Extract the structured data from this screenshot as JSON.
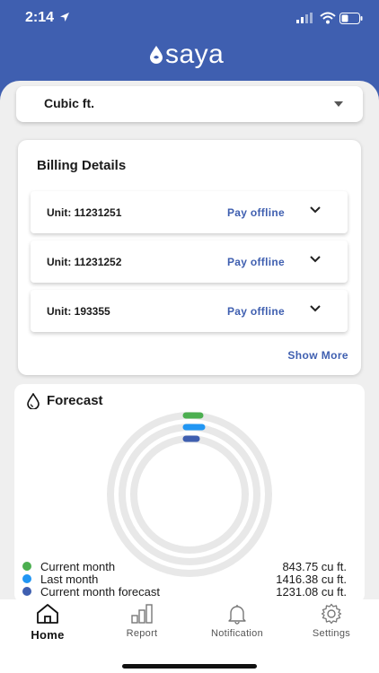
{
  "status_bar": {
    "time": "2:14"
  },
  "brand": {
    "name": "saya"
  },
  "unit_selector": {
    "value": "Cubic ft."
  },
  "billing": {
    "title": "Billing Details",
    "rows": [
      {
        "unit": "Unit: 11231251",
        "action": "Pay offline"
      },
      {
        "unit": "Unit: 11231252",
        "action": "Pay offline"
      },
      {
        "unit": "Unit: 193355",
        "action": "Pay offline"
      }
    ],
    "show_more": "Show More"
  },
  "forecast": {
    "title": "Forecast",
    "legend": [
      {
        "label": "Current month",
        "value": "843.75 cu ft.",
        "color": "#4caf50"
      },
      {
        "label": "Last month",
        "value": "1416.38 cu ft.",
        "color": "#2196f3"
      },
      {
        "label": "Current month forecast",
        "value": "1231.08 cu ft.",
        "color": "#3f5fb0"
      }
    ]
  },
  "tabs": [
    {
      "label": "Home",
      "icon": "home-icon",
      "active": true
    },
    {
      "label": "Report",
      "icon": "bar-chart-icon",
      "active": false
    },
    {
      "label": "Notification",
      "icon": "bell-icon",
      "active": false
    },
    {
      "label": "Settings",
      "icon": "gear-icon",
      "active": false
    }
  ],
  "colors": {
    "brand": "#3f5fb0",
    "background": "#efefef"
  }
}
